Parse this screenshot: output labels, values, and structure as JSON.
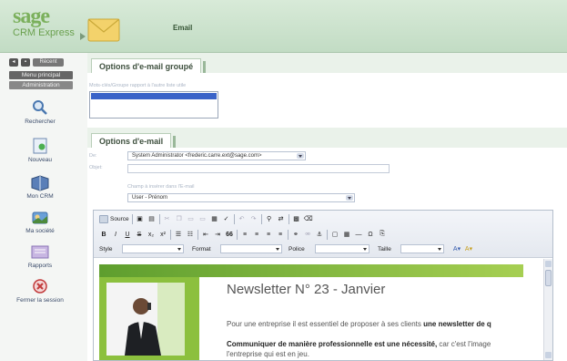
{
  "header": {
    "logo_top": "sage",
    "logo_bottom": "CRM Express",
    "page_title": "Email"
  },
  "sidebar": {
    "recent_label": "Récent",
    "menu_principal": "Menu principal",
    "administration": "Administration",
    "items": [
      {
        "label": "Rechercher",
        "icon": "search-icon"
      },
      {
        "label": "Nouveau",
        "icon": "new-document-icon"
      },
      {
        "label": "Mon CRM",
        "icon": "my-crm-icon"
      },
      {
        "label": "Ma société",
        "icon": "company-icon"
      },
      {
        "label": "Rapports",
        "icon": "reports-icon"
      },
      {
        "label": "Fermer la session",
        "icon": "logout-icon"
      }
    ]
  },
  "group_options": {
    "tab_label": "Options d'e-mail groupé",
    "hint": "Mots-clés/Groupe rapport à l'autre liste utile"
  },
  "email_options": {
    "tab_label": "Options d'e-mail",
    "from_label": "De:",
    "from_value": "System Administrator <frederic.carre.ext@sage.com>",
    "subject_label": "Objet:",
    "subject_value": "",
    "insert_field_label": "Champ à insérer dans l'E-mail",
    "insert_field_value": "User - Prénom"
  },
  "editor": {
    "source_label": "Source",
    "style_label": "Style",
    "format_label": "Format",
    "font_label": "Police",
    "size_label": "Taille",
    "quote_glyph": "66"
  },
  "newsletter": {
    "title": "Newsletter N° 23 - Janvier",
    "p1_prefix": "Pour une entreprise il est essentiel de proposer à ses clients ",
    "p1_bold": "une newsletter de q",
    "p2_bold": "Communiquer de manière professionnelle est une nécessité,",
    "p2_rest": " car c'est l'image",
    "p3": "l'entreprise qui est en jeu."
  },
  "colors": {
    "header_green": "#c2dcc4",
    "brand_green": "#7bb05c",
    "newsletter_green": "#8cc03e",
    "selection_blue": "#3a63c8"
  }
}
